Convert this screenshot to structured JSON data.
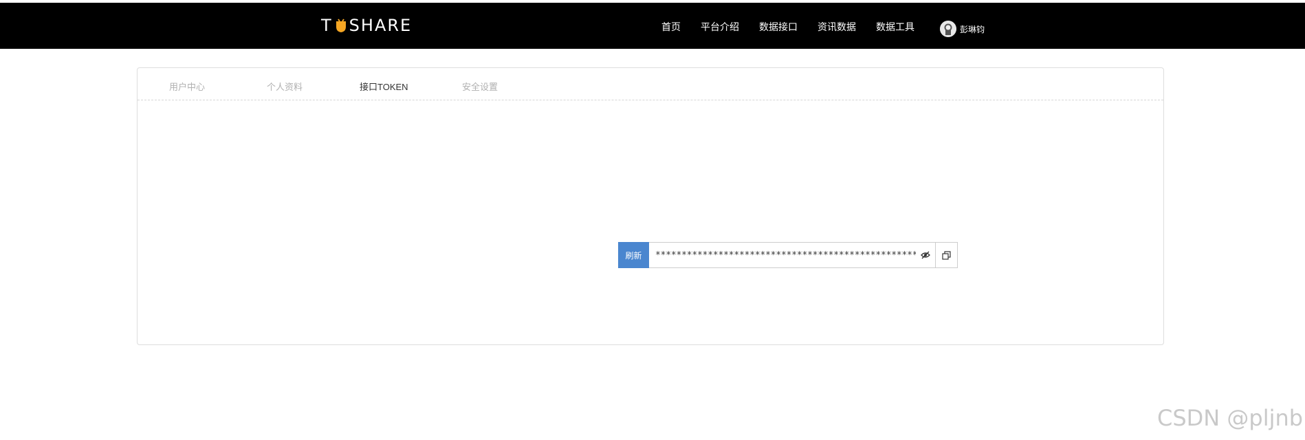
{
  "header": {
    "logo": {
      "prefix": "T",
      "suffix": "SHARE",
      "accent_color": "#f5a623"
    },
    "nav": [
      {
        "label": "首页"
      },
      {
        "label": "平台介绍"
      },
      {
        "label": "数据接口"
      },
      {
        "label": "资讯数据"
      },
      {
        "label": "数据工具"
      }
    ],
    "user": {
      "name": "彭琳钧",
      "avatar_icon": "user-avatar-icon"
    }
  },
  "tabs": [
    {
      "label": "用户中心",
      "active": false
    },
    {
      "label": "个人资料",
      "active": false
    },
    {
      "label": "接口TOKEN",
      "active": true
    },
    {
      "label": "安全设置",
      "active": false
    }
  ],
  "token": {
    "refresh_label": "刷新",
    "masked_value": "*************************************************************",
    "eye_icon": "eye-icon",
    "copy_icon": "copy-icon",
    "button_color": "#4a86cf"
  },
  "watermark": "CSDN @pljnb"
}
